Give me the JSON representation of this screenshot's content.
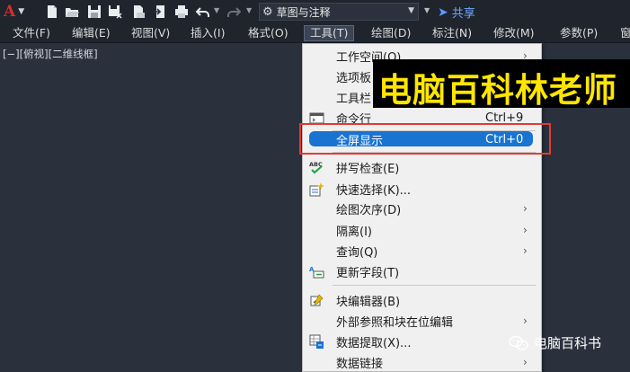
{
  "app": {
    "logo_letter": "A",
    "workspace_name": "草图与注释",
    "share_label": "共享"
  },
  "menubar": {
    "items": [
      {
        "label": "文件(F)"
      },
      {
        "label": "编辑(E)"
      },
      {
        "label": "视图(V)"
      },
      {
        "label": "插入(I)"
      },
      {
        "label": "格式(O)"
      },
      {
        "label": "工具(T)"
      },
      {
        "label": "绘图(D)"
      },
      {
        "label": "标注(N)"
      },
      {
        "label": "修改(M)"
      },
      {
        "label": "参数(P)"
      },
      {
        "label": "窗"
      }
    ],
    "active_index": 5
  },
  "viewport": {
    "label": "[−][俯视][二维线框]"
  },
  "dropdown": {
    "items": [
      {
        "label": "工作空间(O)",
        "shortcut": "",
        "submenu": true
      },
      {
        "label": "选项板",
        "shortcut": "",
        "submenu": false
      },
      {
        "label": "工具栏",
        "shortcut": "",
        "submenu": false
      },
      {
        "label": "命令行",
        "shortcut": "Ctrl+9",
        "submenu": false
      },
      {
        "label": "全屏显示",
        "shortcut": "Ctrl+0",
        "submenu": false,
        "selected": true
      },
      {
        "label": "拼写检查(E)",
        "shortcut": "",
        "submenu": false
      },
      {
        "label": "快速选择(K)...",
        "shortcut": "",
        "submenu": false
      },
      {
        "label": "绘图次序(D)",
        "shortcut": "",
        "submenu": true
      },
      {
        "label": "隔离(I)",
        "shortcut": "",
        "submenu": true
      },
      {
        "label": "查询(Q)",
        "shortcut": "",
        "submenu": true
      },
      {
        "label": "更新字段(T)",
        "shortcut": "",
        "submenu": false
      },
      {
        "label": "块编辑器(B)",
        "shortcut": "",
        "submenu": false
      },
      {
        "label": "外部参照和块在位编辑",
        "shortcut": "",
        "submenu": true
      },
      {
        "label": "数据提取(X)...",
        "shortcut": "",
        "submenu": false
      },
      {
        "label": "数据链接",
        "shortcut": "",
        "submenu": true
      }
    ]
  },
  "watermark": {
    "banner_text": "电脑百科林老师",
    "account_name": "电脑百科书"
  },
  "colors": {
    "highlight": "#1a73d1",
    "banner_text": "#ffe600",
    "annotation_box": "#e53935"
  }
}
